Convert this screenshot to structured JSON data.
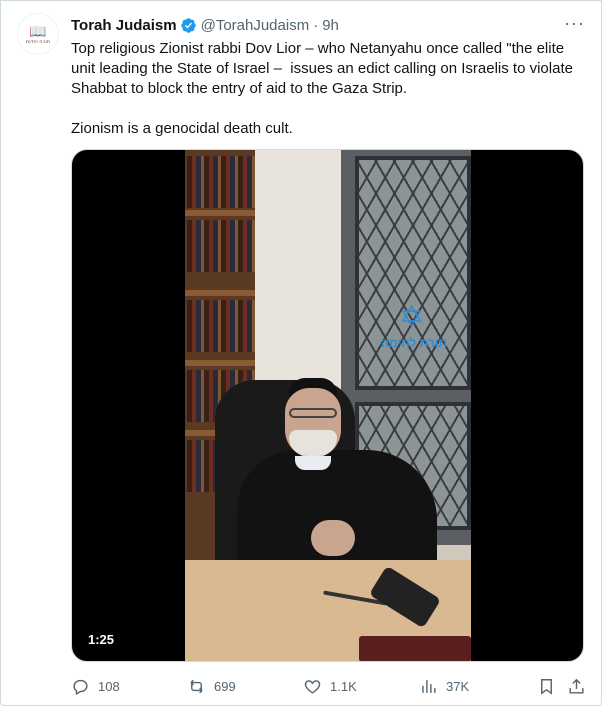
{
  "tweet": {
    "author_name": "Torah Judaism",
    "handle": "@TorahJudaism",
    "separator": "·",
    "time": "9h",
    "more_label": "···",
    "avatar_text": "תורה יהדות",
    "body": "Top religious Zionist rabbi Dov Lior – who Netanyahu once called \"the elite unit leading the State of Israel –  issues an edict calling on Israelis to violate Shabbat to block the entry of aid to the Gaza Strip.\n\nZionism is a genocidal death cult.",
    "video": {
      "duration": "1:25",
      "watermark_text": "תורת לחימה"
    },
    "actions": {
      "replies": "108",
      "reposts": "699",
      "likes": "1.1K",
      "views": "37K"
    },
    "icons": {
      "verified": "verified-badge-icon",
      "reply": "reply-icon",
      "repost": "repost-icon",
      "like": "heart-icon",
      "views": "views-chart-icon",
      "bookmark": "bookmark-icon",
      "share": "share-icon",
      "more": "more-icon"
    },
    "colors": {
      "verified": "#1d9bf0",
      "text": "#0f1419",
      "secondary": "#536471"
    }
  }
}
